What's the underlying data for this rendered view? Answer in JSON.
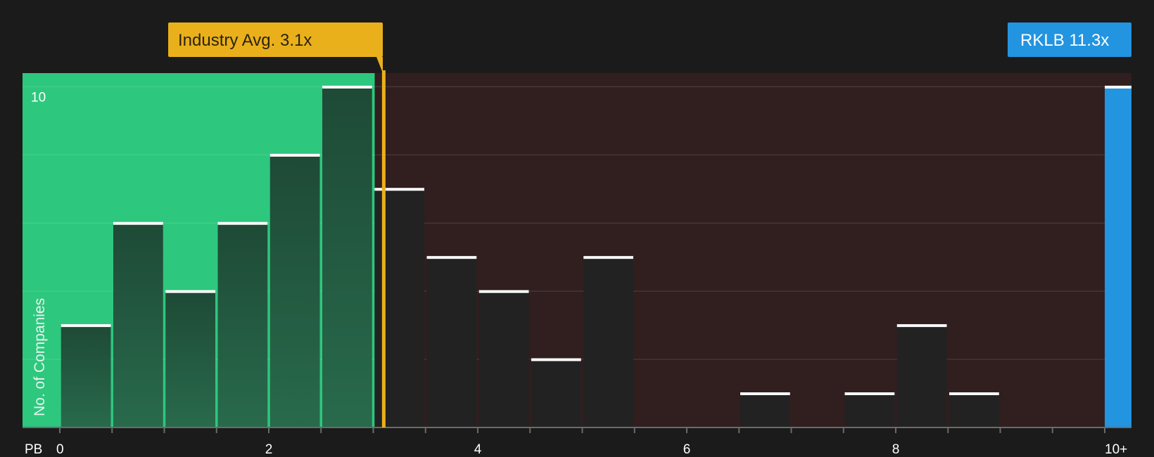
{
  "chart_data": {
    "type": "bar",
    "xlabel": "PB",
    "ylabel": "No. of Companies",
    "ylim": [
      0,
      10.4
    ],
    "y_ticks": [
      {
        "value": 10,
        "label": "10"
      }
    ],
    "x_ticks": [
      {
        "value": 0,
        "label": "0"
      },
      {
        "value": 2,
        "label": "2"
      },
      {
        "value": 4,
        "label": "4"
      },
      {
        "value": 6,
        "label": "6"
      },
      {
        "value": 8,
        "label": "8"
      },
      {
        "value": 10,
        "label": "10+"
      }
    ],
    "bins": [
      {
        "start": 0.0,
        "end": 0.5,
        "count": 3
      },
      {
        "start": 0.5,
        "end": 1.0,
        "count": 6
      },
      {
        "start": 1.0,
        "end": 1.5,
        "count": 4
      },
      {
        "start": 1.5,
        "end": 2.0,
        "count": 6
      },
      {
        "start": 2.0,
        "end": 2.5,
        "count": 8
      },
      {
        "start": 2.5,
        "end": 3.0,
        "count": 10
      },
      {
        "start": 3.0,
        "end": 3.5,
        "count": 7
      },
      {
        "start": 3.5,
        "end": 4.0,
        "count": 5
      },
      {
        "start": 4.0,
        "end": 4.5,
        "count": 4
      },
      {
        "start": 4.5,
        "end": 5.0,
        "count": 2
      },
      {
        "start": 5.0,
        "end": 5.5,
        "count": 5
      },
      {
        "start": 5.5,
        "end": 6.0,
        "count": 0
      },
      {
        "start": 6.0,
        "end": 6.5,
        "count": 0
      },
      {
        "start": 6.5,
        "end": 7.0,
        "count": 1
      },
      {
        "start": 7.0,
        "end": 7.5,
        "count": 0
      },
      {
        "start": 7.5,
        "end": 8.0,
        "count": 1
      },
      {
        "start": 8.0,
        "end": 8.5,
        "count": 3
      },
      {
        "start": 8.5,
        "end": 9.0,
        "count": 1
      },
      {
        "start": 9.0,
        "end": 9.5,
        "count": 0
      },
      {
        "start": 9.5,
        "end": 10.0,
        "count": 0
      }
    ],
    "industry_average": {
      "value": 3.1,
      "label": "Industry Avg. 3.1x"
    },
    "company": {
      "ticker": "RKLB",
      "value": 11.3,
      "label": "RKLB 11.3x",
      "count": 10
    },
    "colors": {
      "background": "#1b1b1b",
      "undervalued_zone": "#2ec77e",
      "overvalued_zone": "#311e1f",
      "bar_dark": "#222222",
      "bar_cap": "#ffffff",
      "industry_marker": "#eab01c",
      "company_bar": "#2394e0",
      "gridline": "#4a3c3c",
      "axis_line": "#6b6b6b"
    }
  }
}
